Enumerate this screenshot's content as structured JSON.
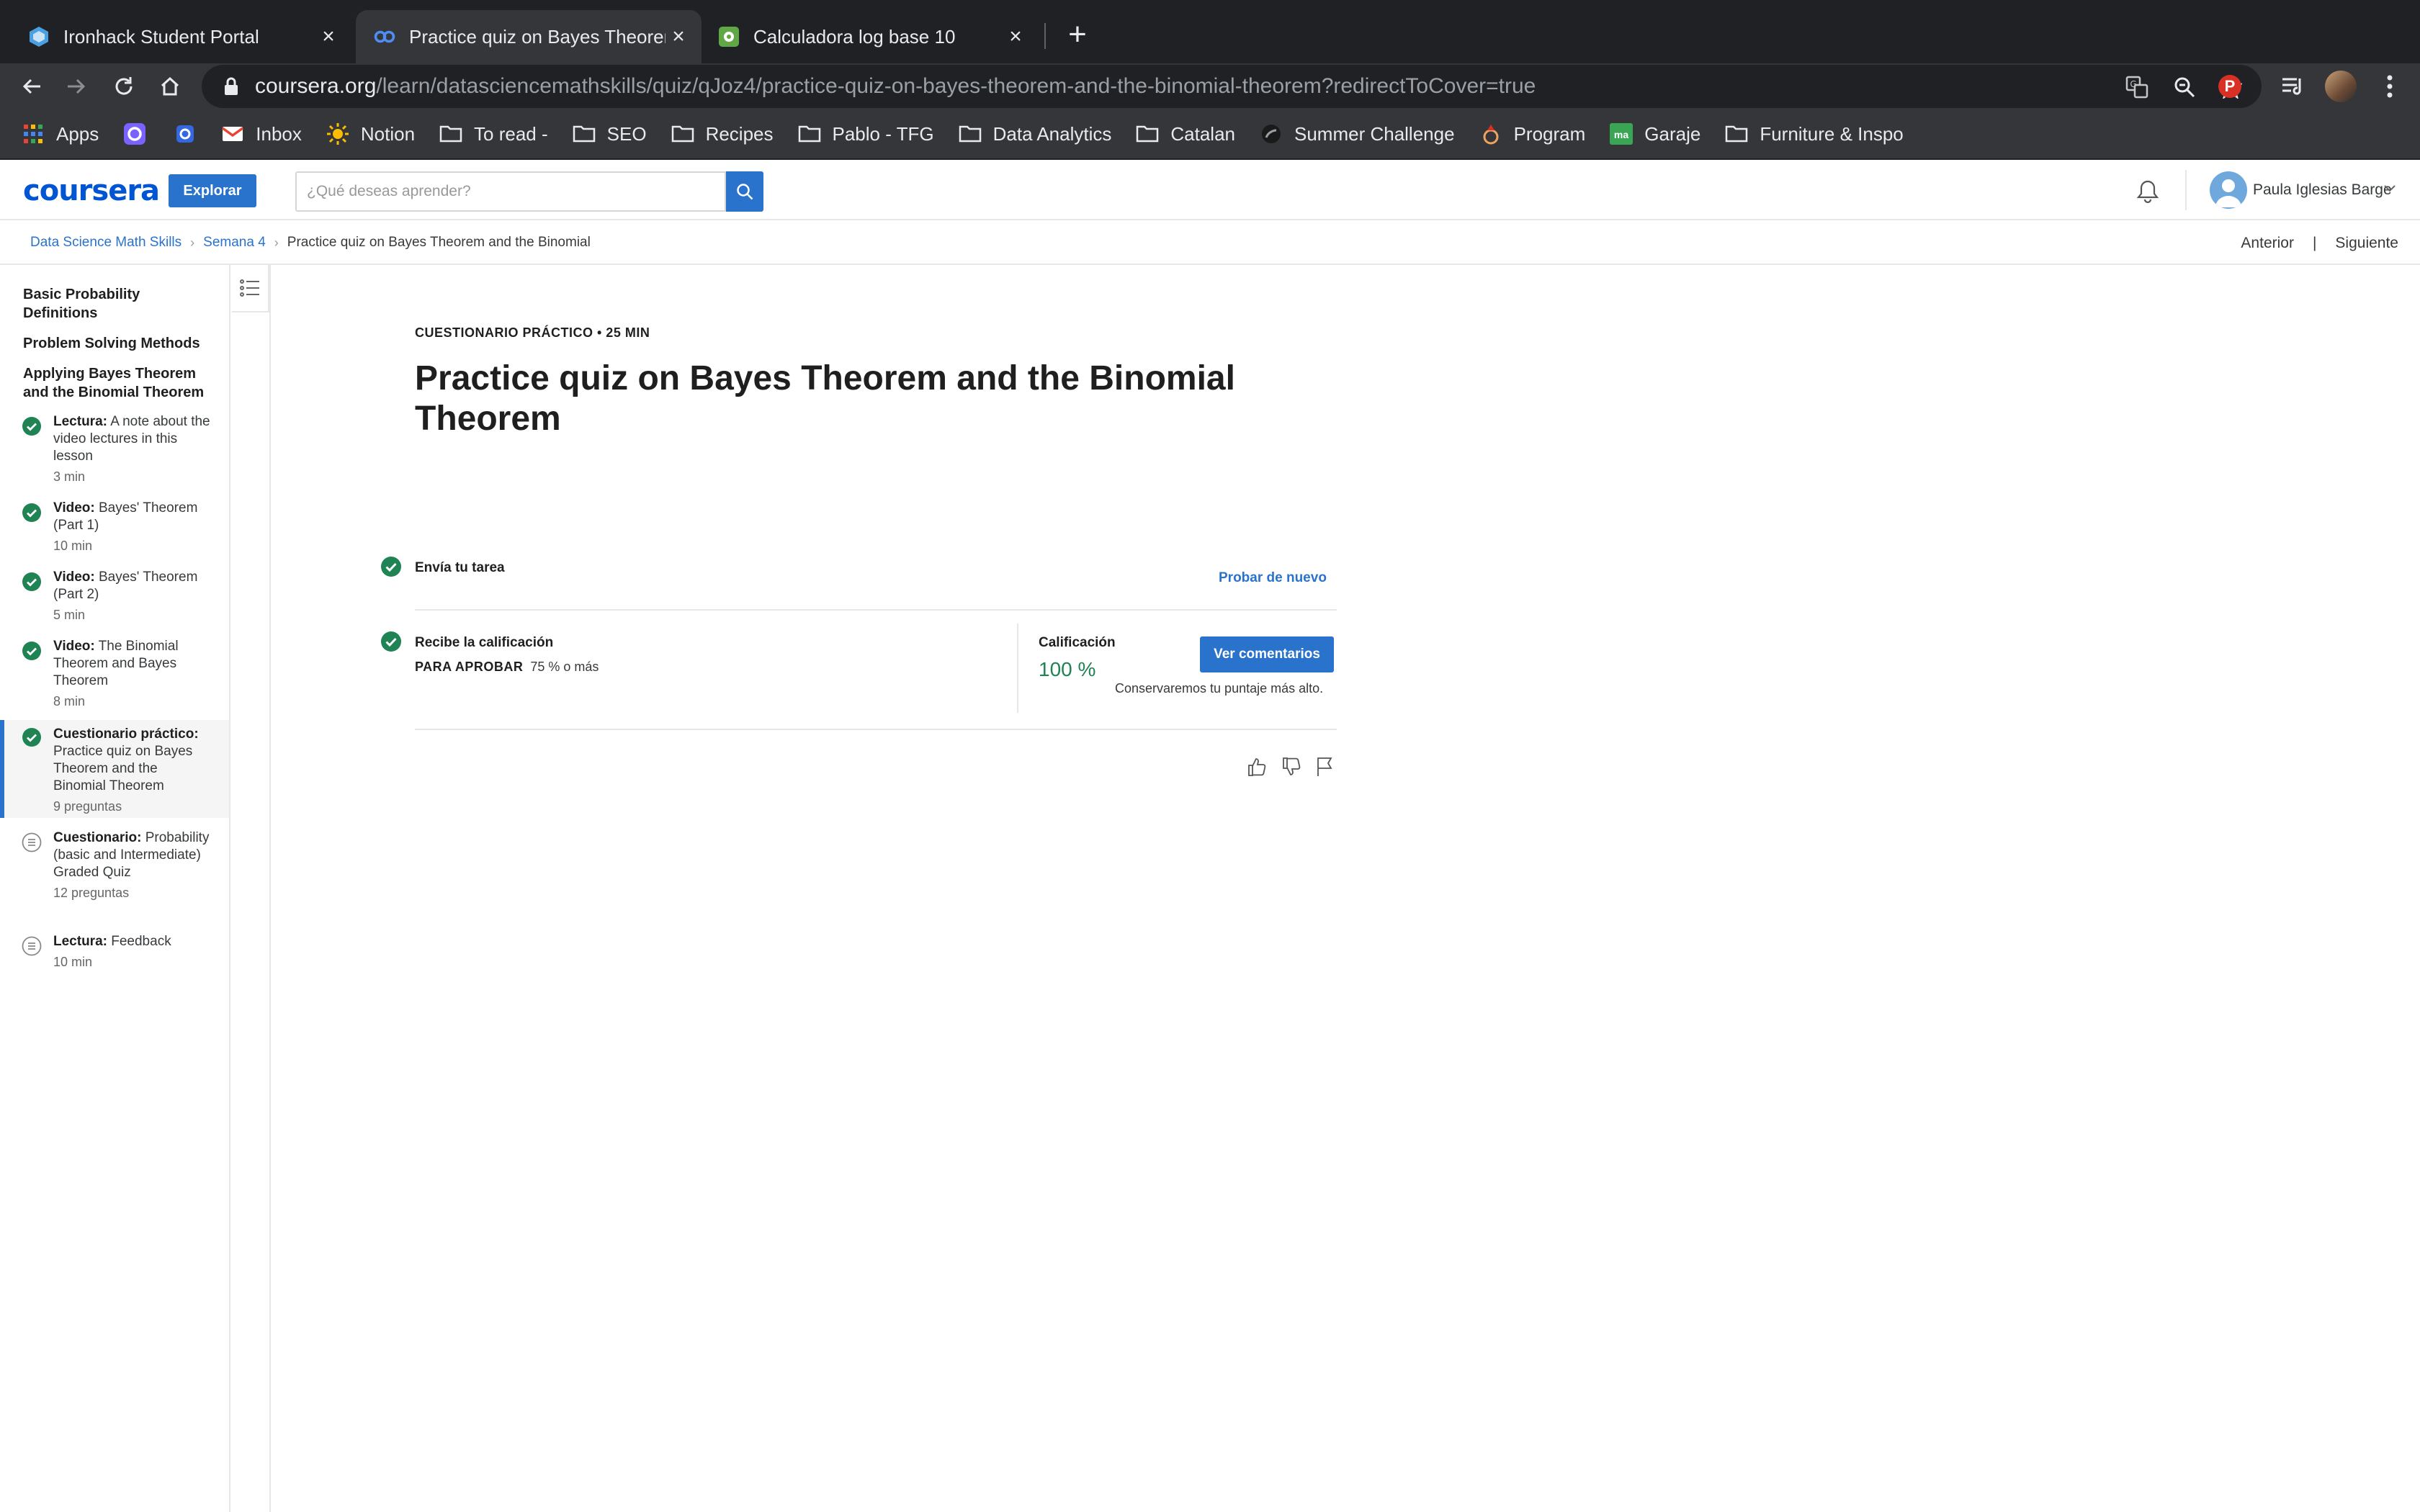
{
  "browser": {
    "tabs": [
      {
        "title": "Ironhack Student Portal",
        "favicon": "ironhack-icon"
      },
      {
        "title": "Practice quiz on Bayes Theorem and the Binomial Theorem",
        "favicon": "coursera-icon",
        "active": true
      },
      {
        "title": "Calculadora log base 10",
        "favicon": "calculator-icon"
      }
    ],
    "url_host": "coursera.org",
    "url_path": "/learn/datasciencemathskills/quiz/qJoz4/practice-quiz-on-bayes-theorem-and-the-binomial-theorem?redirectToCover=true",
    "profile_letter": "P",
    "bookmarks": [
      {
        "label": "Apps",
        "icon": "apps-grid-icon"
      },
      {
        "label": "",
        "icon": "app-icon-1"
      },
      {
        "label": "",
        "icon": "app-icon-2"
      },
      {
        "label": "Inbox",
        "icon": "gmail-icon"
      },
      {
        "label": "Notion",
        "icon": "sun-icon"
      },
      {
        "label": "To read -",
        "icon": "folder-icon"
      },
      {
        "label": "SEO",
        "icon": "folder-icon"
      },
      {
        "label": "Recipes",
        "icon": "folder-icon"
      },
      {
        "label": "Pablo - TFG",
        "icon": "folder-icon"
      },
      {
        "label": "Data Analytics",
        "icon": "folder-icon"
      },
      {
        "label": "Catalan",
        "icon": "folder-icon"
      },
      {
        "label": "Summer Challenge",
        "icon": "summer-challenge-icon"
      },
      {
        "label": "Program",
        "icon": "program-icon"
      },
      {
        "label": "Garaje",
        "icon": "garaje-icon"
      },
      {
        "label": "Furniture & Inspo",
        "icon": "folder-icon"
      }
    ]
  },
  "header": {
    "logo": "coursera",
    "explore_label": "Explorar",
    "search_placeholder": "¿Qué deseas aprender?",
    "user_name": "Paula Iglesias Barge"
  },
  "breadcrumb": {
    "items": [
      "Data Science Math Skills",
      "Semana 4",
      "Practice quiz on Bayes Theorem and the Binomial"
    ],
    "prev": "Anterior",
    "next": "Siguiente"
  },
  "sidebar": {
    "sections": [
      "Basic Probability Definitions",
      "Problem Solving Methods",
      "Applying Bayes Theorem and the Binomial Theorem"
    ],
    "items": [
      {
        "type": "Lectura:",
        "title": "A note about the video lectures in this lesson",
        "meta": "3 min",
        "status": "completed"
      },
      {
        "type": "Video:",
        "title": "Bayes' Theorem (Part 1)",
        "meta": "10 min",
        "status": "completed"
      },
      {
        "type": "Video:",
        "title": "Bayes' Theorem (Part 2)",
        "meta": "5 min",
        "status": "completed"
      },
      {
        "type": "Video:",
        "title": "The Binomial Theorem and Bayes Theorem",
        "meta": "8 min",
        "status": "completed"
      },
      {
        "type": "Cuestionario práctico:",
        "title": "Practice quiz on Bayes Theorem and the Binomial Theorem",
        "meta": "9 preguntas",
        "status": "completed",
        "active": true
      },
      {
        "type": "Cuestionario:",
        "title": "Probability (basic and Intermediate) Graded Quiz",
        "meta": "12 preguntas",
        "status": "pending"
      },
      {
        "type": "Lectura:",
        "title": "Feedback",
        "meta": "10 min",
        "status": "pending"
      }
    ]
  },
  "main": {
    "kicker": "CUESTIONARIO PRÁCTICO • 25 MIN",
    "title": "Practice quiz on Bayes Theorem and the Binomial Theorem",
    "step1_label": "Envía tu tarea",
    "retry_label": "Probar de nuevo",
    "step2_label": "Recibe la calificación",
    "pass_label": "PARA APROBAR",
    "pass_value": "75 % o más",
    "grade_label": "Calificación",
    "grade_value": "100 %",
    "view_feedback_label": "Ver comentarios",
    "keep_note": "Conservaremos tu puntaje más alto."
  },
  "colors": {
    "brand": "#0056d2",
    "button": "#2a73cc",
    "success": "#1f8354",
    "chrome_dark": "#202124",
    "chrome_mid": "#35363a"
  }
}
